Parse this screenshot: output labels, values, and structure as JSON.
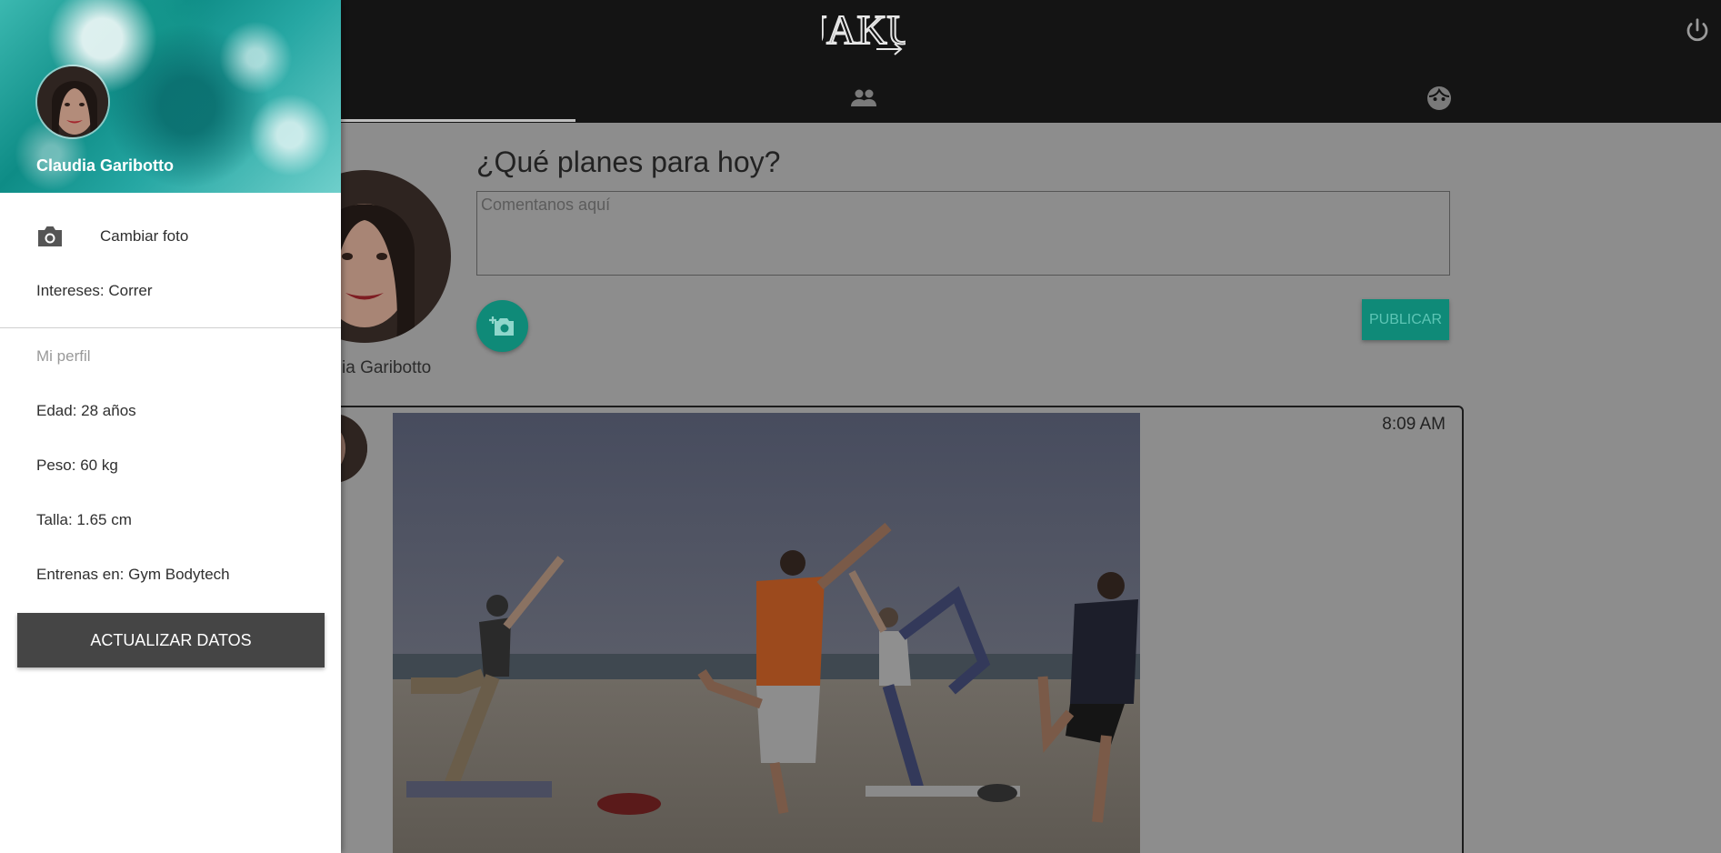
{
  "app": {
    "logo_text": "JAKU"
  },
  "composer": {
    "title": "¿Qué planes para hoy?",
    "placeholder": "Comentanos aquí",
    "publish_label": "PUBLICAR",
    "user_name_partial": "ia Garibotto"
  },
  "post": {
    "time": "8:09 AM"
  },
  "drawer": {
    "user_name": "Claudia Garibotto",
    "change_photo": "Cambiar foto",
    "interests": "Intereses: Correr",
    "profile_label": "Mi perfil",
    "age": "Edad: 28 años",
    "weight": "Peso: 60 kg",
    "height": "Talla: 1.65 cm",
    "gym": "Entrenas en: Gym Bodytech",
    "update_button": "ACTUALIZAR DATOS"
  },
  "icons": {
    "tab1": "people-icon",
    "tab2": "face-icon",
    "power": "power-icon",
    "camera": "camera-icon",
    "add_photo": "add-photo-icon"
  },
  "colors": {
    "accent": "#1fbfa6",
    "drawer_button": "#454545",
    "topbar": "#141414"
  }
}
